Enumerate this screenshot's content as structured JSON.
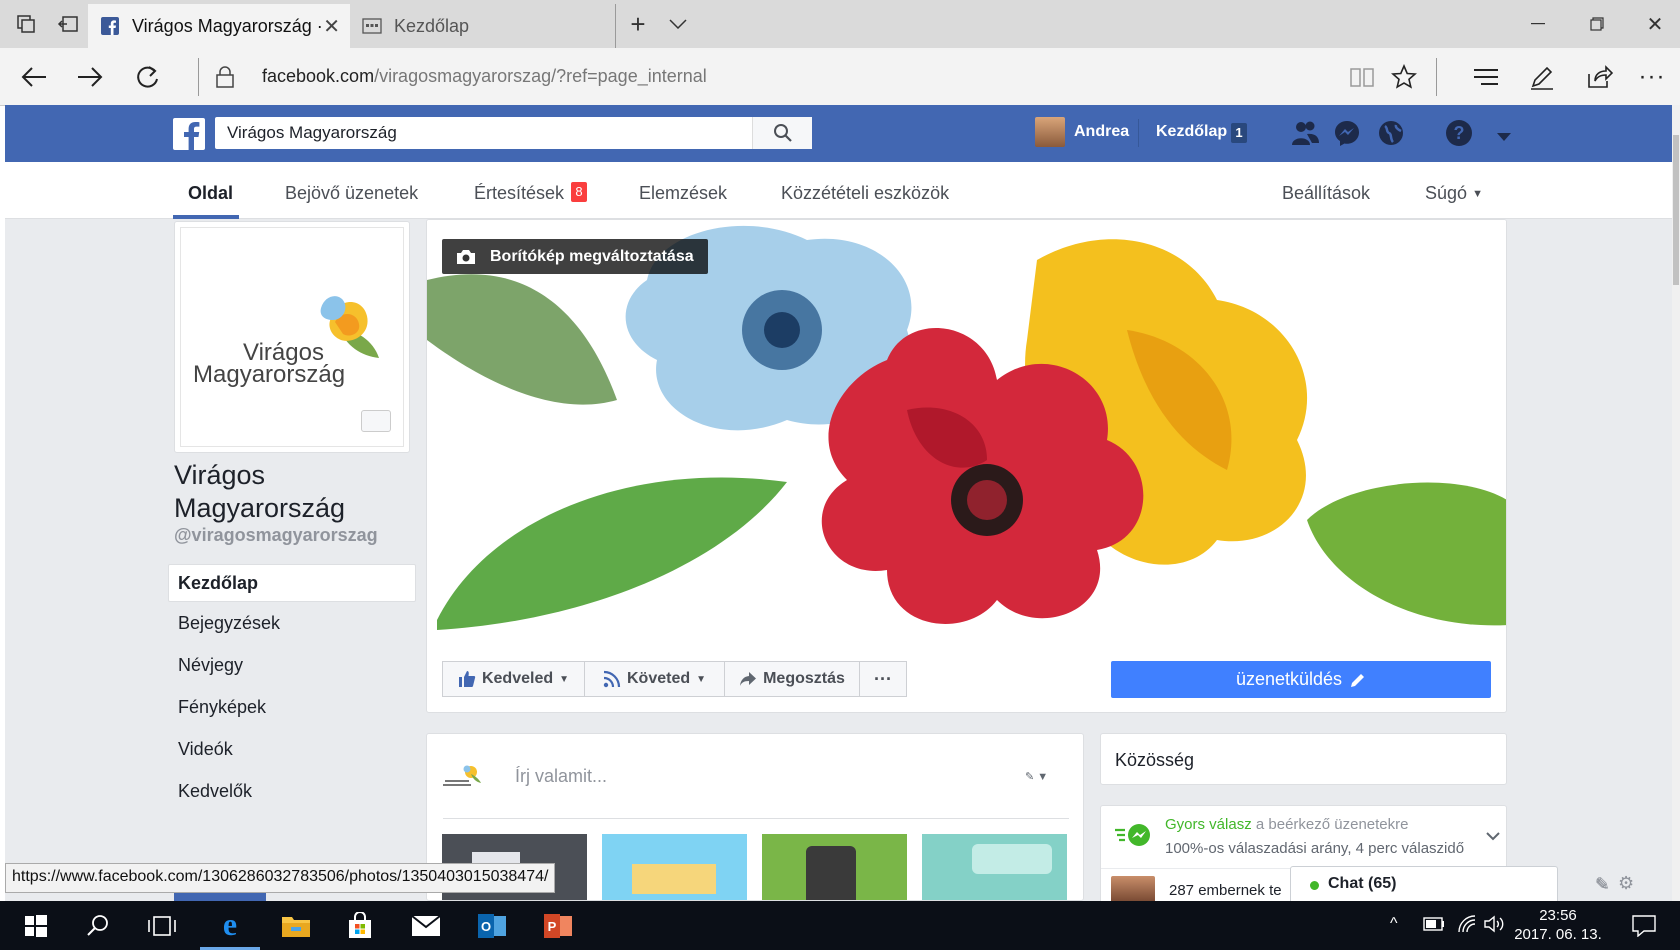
{
  "browser": {
    "tab_active_title": "Virágos Magyarország ·",
    "tab_other_title": "Kezdőlap",
    "url_domain": "facebook.com",
    "url_path": "/viragosmagyarorszag/?ref=page_internal"
  },
  "fb_header": {
    "search_value": "Virágos Magyarország",
    "user_name": "Andrea",
    "home_label": "Kezdőlap",
    "home_count": "1"
  },
  "page_nav": {
    "items": [
      "Oldal",
      "Bejövő üzenetek",
      "Értesítések",
      "Elemzések",
      "Közzétételi eszközök"
    ],
    "notifications_badge": "8",
    "settings": "Beállítások",
    "help": "Súgó"
  },
  "profile": {
    "logo_line1": "Virágos",
    "logo_line2": "Magyarország",
    "name_line1": "Virágos",
    "name_line2": "Magyarország",
    "handle": "@viragosmagyarorszag"
  },
  "sidebar": {
    "items": [
      "Kezdőlap",
      "Bejegyzések",
      "Névjegy",
      "Fényképek",
      "Videók",
      "Kedvelők"
    ]
  },
  "cover": {
    "change_button": "Borítókép megváltoztatása"
  },
  "actions": {
    "like": "Kedveled",
    "follow": "Követed",
    "share": "Megosztás",
    "more": "···",
    "message": "üzenetküldés"
  },
  "composer": {
    "placeholder": "Írj valamit..."
  },
  "community": {
    "title": "Közösség",
    "quick_reply_label": "Gyors válasz",
    "quick_reply_rest": "a beérkező üzenetekre",
    "response_rate": "100%-os válaszadási arány, 4 perc válaszidő",
    "people_text": "287 embernek te"
  },
  "chat": {
    "label": "Chat (65)"
  },
  "status_bar": {
    "link": "https://www.facebook.com/1306286032783506/photos/1350403015038474/"
  },
  "taskbar": {
    "time": "23:56",
    "date": "2017. 06. 13."
  },
  "colors": {
    "fb_blue": "#4267b2",
    "message_button": "#4080ff",
    "badge_red": "#fa3e3e",
    "quick_reply_green": "#42b72a"
  }
}
